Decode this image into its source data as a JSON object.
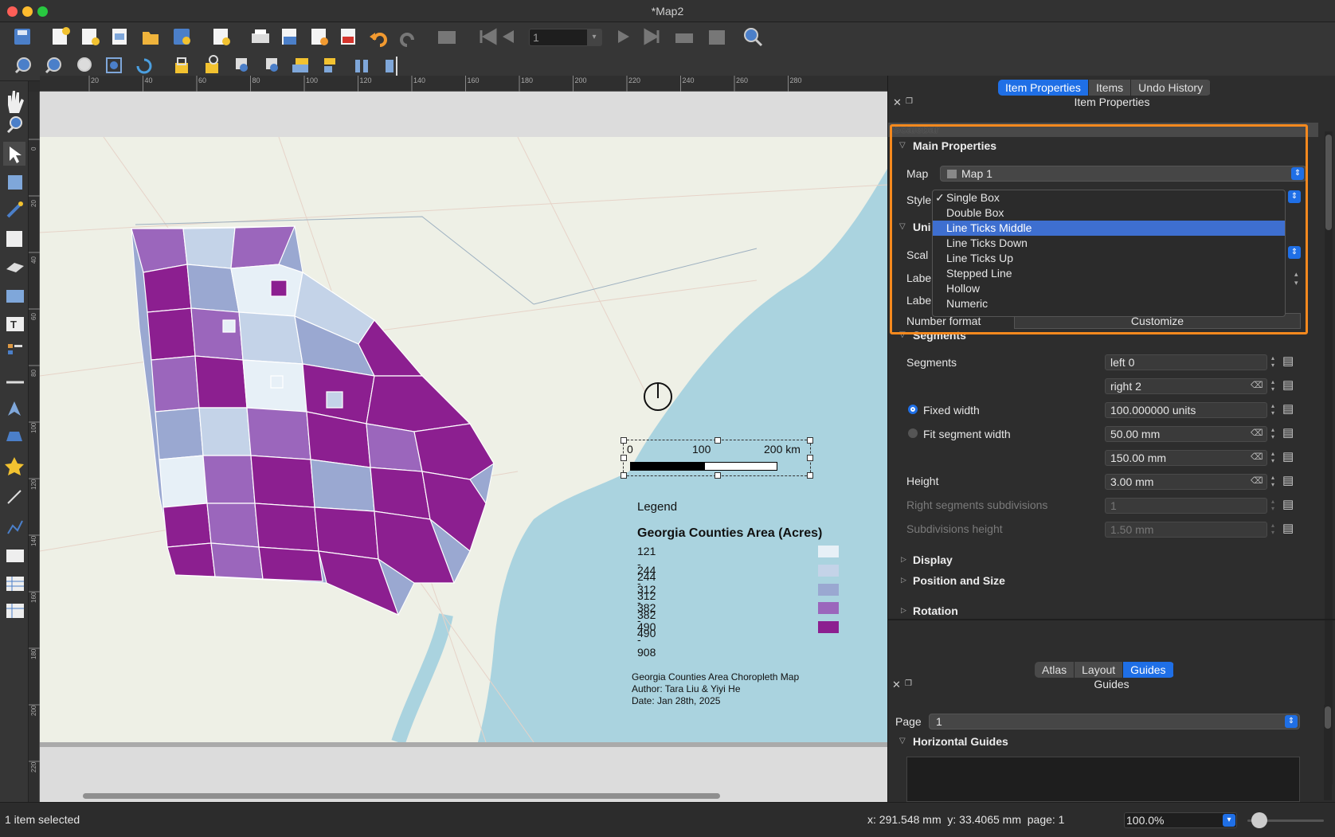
{
  "window": {
    "title": "*Map2"
  },
  "toolbar": {
    "page_value": "1",
    "icons_row1": [
      "save-icon",
      "new-layout-icon",
      "duplicate-layout-icon",
      "layout-manager-icon",
      "open-template-icon",
      "save-template-icon",
      "new-report-icon",
      "print-icon",
      "export-image-icon",
      "export-svg-icon",
      "export-pdf-icon",
      "undo-icon",
      "redo-icon",
      "atlas-preview-icon",
      "first-feature-icon",
      "prev-feature-icon",
      "next-feature-icon",
      "last-feature-icon",
      "atlas-print-icon",
      "atlas-export-icon",
      "atlas-settings-icon"
    ],
    "icons_row2": [
      "zoom-in-icon",
      "zoom-out-icon",
      "zoom-100-icon",
      "zoom-full-icon",
      "refresh-icon",
      "lock-items-icon",
      "unlock-items-icon",
      "group-icon",
      "ungroup-icon",
      "raise-icon",
      "align-icon",
      "distribute-icon",
      "resize-icon"
    ]
  },
  "left_tools": [
    "pan-icon",
    "zoom-tool-icon",
    "select-icon",
    "move-content-icon",
    "edit-nodes-icon",
    "add-map-icon",
    "add-3d-map-icon",
    "add-picture-icon",
    "add-label-icon",
    "add-legend-icon",
    "add-scalebar-icon",
    "add-north-arrow-icon",
    "add-shape-icon",
    "add-marker-icon",
    "add-arrow-icon",
    "add-polyline-icon",
    "add-html-icon",
    "add-table-icon",
    "add-fixed-table-icon"
  ],
  "ruler": {
    "h_ticks": [
      "20",
      "40",
      "60",
      "80",
      "100",
      "120",
      "140",
      "160",
      "180",
      "200",
      "220",
      "240",
      "260",
      "280"
    ],
    "v_ticks": [
      "0",
      "20",
      "40",
      "60",
      "80",
      "100",
      "120",
      "140",
      "160",
      "180",
      "200",
      "220"
    ]
  },
  "map": {
    "scalebar_labels": [
      "0",
      "100",
      "200 km"
    ],
    "legend": {
      "title": "Legend",
      "subtitle": "Georgia Counties Area (Acres)",
      "classes": [
        {
          "label": "121 - 244",
          "color": "#e7f0f7"
        },
        {
          "label": "244 - 312",
          "color": "#c4d3e8"
        },
        {
          "label": "312 - 382",
          "color": "#9aa8d1"
        },
        {
          "label": "382 - 490",
          "color": "#9b66bc"
        },
        {
          "label": "490 - 908",
          "color": "#8c1f90"
        }
      ]
    },
    "caption": [
      "Georgia Counties Area Choropleth Map",
      "Author: Tara Liu & Yiyi He",
      "Date: Jan 28th, 2025"
    ]
  },
  "panel": {
    "tabs": [
      "Item Properties",
      "Items",
      "Undo History"
    ],
    "active_tab": "Item Properties",
    "header": "Item Properties",
    "item_type": "Scalebar",
    "main_properties": "Main Properties",
    "map_label": "Map",
    "map_value": "Map 1",
    "style_label": "Style",
    "style_options": [
      "Single Box",
      "Double Box",
      "Line Ticks Middle",
      "Line Ticks Down",
      "Line Ticks Up",
      "Stepped Line",
      "Hollow",
      "Numeric"
    ],
    "style_checked": "Single Box",
    "style_hovered": "Line Ticks Middle",
    "units_partial": "Uni",
    "scale_partial": "Scal",
    "label_partial1": "Labe",
    "label_partial2": "Labe",
    "number_format_label": "Number format",
    "customize_label": "Customize",
    "segments_group": "Segments",
    "segments_label": "Segments",
    "left_value": "left 0",
    "right_value": "right 2",
    "fixed_width_label": "Fixed width",
    "fixed_width_value": "100.000000 units",
    "fit_width_label": "Fit segment width",
    "fit_min": "50.00 mm",
    "fit_max": "150.00 mm",
    "height_label": "Height",
    "height_value": "3.00 mm",
    "right_sub_label": "Right segments subdivisions",
    "right_sub_value": "1",
    "sub_height_label": "Subdivisions height",
    "sub_height_value": "1.50 mm",
    "display": "Display",
    "position_size": "Position and Size",
    "rotation": "Rotation"
  },
  "guides": {
    "tabs": [
      "Atlas",
      "Layout",
      "Guides"
    ],
    "active_tab": "Guides",
    "header": "Guides",
    "page_label": "Page",
    "page_value": "1",
    "horizontal": "Horizontal Guides"
  },
  "status": {
    "selection": "1 item selected",
    "coords": "x: 291.548 mm  y: 33.4065 mm  page: 1",
    "zoom": "100.0%"
  },
  "colors": {
    "accent": "#1f6fe6",
    "highlight": "#f5891e",
    "water": "#aad3df",
    "land": "#eef0e6"
  }
}
